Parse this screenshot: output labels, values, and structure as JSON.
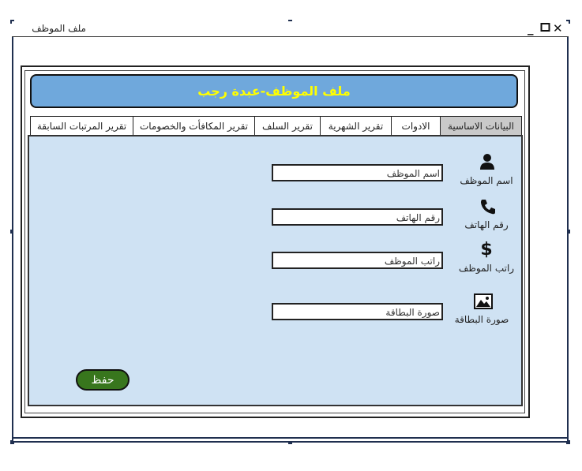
{
  "window": {
    "title": "ملف الموظف",
    "controls": {
      "minimize": "_",
      "maximize": "☐",
      "close": "✕"
    }
  },
  "header": {
    "title": "ملف الموظف-عبدة رجب",
    "color": "#ffff00",
    "background": "#6fa8dc"
  },
  "tabs": [
    {
      "label": "البيانات الاساسية",
      "active": true
    },
    {
      "label": "الادوات",
      "active": false
    },
    {
      "label": "تقرير الشهرية",
      "active": false
    },
    {
      "label": "تقرير السلف",
      "active": false
    },
    {
      "label": "تقرير المكافأت والخصومات",
      "active": false
    },
    {
      "label": "تقرير المرتبات السابقة",
      "active": false
    }
  ],
  "form": {
    "name": {
      "label": "اسم الموظف",
      "value": "اسم الموظف",
      "icon": "user-icon"
    },
    "phone": {
      "label": "رقم الهاتف",
      "value": "رقم الهاتف",
      "icon": "phone-icon"
    },
    "salary": {
      "label": "راتب الموظف",
      "value": "راتب الموظف",
      "icon": "dollar-icon"
    },
    "card": {
      "label": "صورة البطاقة",
      "value": "صورة البطاقة",
      "icon": "image-icon"
    }
  },
  "save_button": {
    "label": "حفظ",
    "color": "#38761d"
  },
  "colors": {
    "content_bg": "#cfe2f3",
    "frame": "#1f2f4f"
  }
}
